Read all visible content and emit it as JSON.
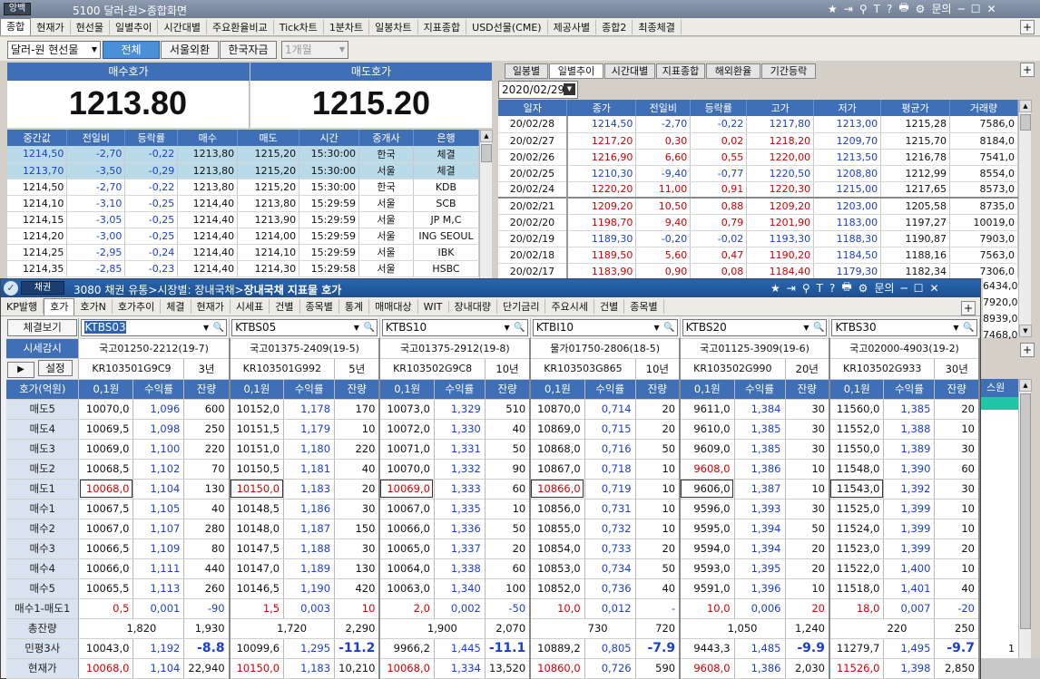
{
  "main_window": {
    "logo": "앙백",
    "title": "5100 달러-원>종합화면",
    "title_buttons": [
      "★",
      "⇥",
      "⚲",
      "T",
      "?",
      "🖶",
      "⚙",
      "문의",
      "─",
      "☐",
      "✕"
    ],
    "tabs": [
      "종합",
      "현재가",
      "현선물",
      "일별추이",
      "시간대별",
      "주요환율비교",
      "Tick차트",
      "1분차트",
      "일봉차트",
      "지표종합",
      "USD선물(CME)",
      "제공사별",
      "종합2",
      "최종체결"
    ],
    "filter": {
      "select_value": "달러-원 현선물",
      "btn_all": "전체",
      "btn_seoul": "서울외환",
      "btn_korea": "한국자금",
      "period": "1개월"
    },
    "quote": {
      "bid_label": "매수호가",
      "ask_label": "매도호가",
      "bid": "1213.80",
      "ask": "1215.20"
    },
    "trade_headers": [
      "중간값",
      "전일비",
      "등락률",
      "매수",
      "매도",
      "시간",
      "중개사",
      "은행"
    ],
    "trade_rows": [
      [
        "1214,50",
        "-2,70",
        "-0,22",
        "1213,80",
        "1215,20",
        "15:30:00",
        "한국",
        "체결"
      ],
      [
        "1213,70",
        "-3,50",
        "-0,29",
        "1213,80",
        "1215,20",
        "15:30:00",
        "서울",
        "체결"
      ],
      [
        "1214,50",
        "-2,70",
        "-0,22",
        "1213,80",
        "1215,20",
        "15:30:00",
        "한국",
        "KDB"
      ],
      [
        "1214,10",
        "-3,10",
        "-0,25",
        "1214,40",
        "1213,80",
        "15:29:59",
        "서울",
        "SCB"
      ],
      [
        "1214,15",
        "-3,05",
        "-0,25",
        "1214,40",
        "1213,90",
        "15:29:59",
        "서울",
        "JP M,C"
      ],
      [
        "1214,20",
        "-3,00",
        "-0,25",
        "1214,40",
        "1214,00",
        "15:29:59",
        "서울",
        "ING SEOUL"
      ],
      [
        "1214,25",
        "-2,95",
        "-0,24",
        "1214,40",
        "1214,10",
        "15:29:59",
        "서울",
        "IBK"
      ],
      [
        "1214,35",
        "-2,85",
        "-0,23",
        "1214,40",
        "1214,30",
        "15:29:58",
        "서울",
        "HSBC"
      ]
    ],
    "right_tabs": [
      "일봉별",
      "일별추이",
      "시간대별",
      "지표종합",
      "해외환율",
      "기간등락"
    ],
    "date": "2020/02/29",
    "daily_headers": [
      "일자",
      "종가",
      "전일비",
      "등락률",
      "고가",
      "저가",
      "평균가",
      "거래량"
    ],
    "daily_rows": [
      [
        "20/02/28",
        "1214,50",
        "-2,70",
        "-0,22",
        "1217,80",
        "1213,00",
        "1215,28",
        "7586,0"
      ],
      [
        "20/02/27",
        "1217,20",
        "0,30",
        "0,02",
        "1218,20",
        "1209,70",
        "1215,70",
        "8184,0"
      ],
      [
        "20/02/26",
        "1216,90",
        "6,60",
        "0,55",
        "1220,00",
        "1213,50",
        "1216,78",
        "7541,0"
      ],
      [
        "20/02/25",
        "1210,30",
        "-9,40",
        "-0,77",
        "1220,50",
        "1208,80",
        "1212,99",
        "8554,0"
      ],
      [
        "20/02/24",
        "1220,20",
        "11,00",
        "0,91",
        "1220,30",
        "1215,00",
        "1217,65",
        "8573,0"
      ],
      [
        "20/02/21",
        "1209,20",
        "10,50",
        "0,88",
        "1209,20",
        "1203,00",
        "1205,58",
        "8735,0"
      ],
      [
        "20/02/20",
        "1198,70",
        "9,40",
        "0,79",
        "1201,90",
        "1183,00",
        "1197,27",
        "10019,0"
      ],
      [
        "20/02/19",
        "1189,30",
        "-0,20",
        "-0,02",
        "1193,30",
        "1188,30",
        "1190,87",
        "7903,0"
      ],
      [
        "20/02/18",
        "1189,50",
        "5,60",
        "0,47",
        "1190,20",
        "1184,50",
        "1188,16",
        "7563,0"
      ],
      [
        "20/02/17",
        "1183,90",
        "0,90",
        "0,08",
        "1184,40",
        "1179,30",
        "1182,34",
        "7306,0"
      ]
    ],
    "daily_peek": [
      "6434,0",
      "7920,0",
      "8939,0",
      "7468,0"
    ],
    "side_label": "스원",
    "side_value": "1"
  },
  "bond_window": {
    "logo": "채권",
    "title_prefix": "3080 채권 유통>시장별: 장내국채>",
    "title_bold": "장내국채 지표물 호가",
    "title_buttons": [
      "★",
      "⇥",
      "⚲",
      "T",
      "?",
      "🖶",
      "⚙",
      "문의",
      "─",
      "☐",
      "✕"
    ],
    "tabs": [
      "KP발행",
      "호가",
      "호가N",
      "호가추이",
      "체결",
      "현재가",
      "시세표",
      "건별",
      "종목별",
      "통계",
      "매매대상",
      "WIT",
      "장내대량",
      "단기금리",
      "주요시세",
      "건별",
      "종목별"
    ],
    "left_btn_view": "체결보기",
    "left_btn_price": "시세감시",
    "left_btn_setting": "설정",
    "label_quote": "호가(억원)",
    "row_labels": [
      "매도5",
      "매도4",
      "매도3",
      "매도2",
      "매도1",
      "매수1",
      "매수2",
      "매수3",
      "매수4",
      "매수5",
      "매수1-매도1",
      "총잔량",
      "민평3사",
      "현재가"
    ],
    "col_headers": [
      "0,1원",
      "수익률",
      "잔량"
    ],
    "bonds": [
      {
        "code": "KTBS03",
        "name": "국고01250-2212(19-7)",
        "isin": "KR103501G9C9",
        "term": "3년",
        "rows": [
          [
            "10070,0",
            "1,096",
            "600"
          ],
          [
            "10069,5",
            "1,098",
            "250"
          ],
          [
            "10069,0",
            "1,100",
            "220"
          ],
          [
            "10068,5",
            "1,102",
            "70"
          ],
          [
            "10068,0",
            "1,104",
            "130"
          ],
          [
            "10067,5",
            "1,105",
            "40"
          ],
          [
            "10067,0",
            "1,107",
            "280"
          ],
          [
            "10066,5",
            "1,109",
            "80"
          ],
          [
            "10066,0",
            "1,111",
            "440"
          ],
          [
            "10065,5",
            "1,113",
            "260"
          ],
          [
            "0,5",
            "0,001",
            "-90"
          ],
          [
            "1,820",
            "",
            "1,930"
          ],
          [
            "10043,0",
            "1,192",
            "-8.8"
          ],
          [
            "10068,0",
            "1,104",
            "22,940"
          ]
        ]
      },
      {
        "code": "KTBS05",
        "name": "국고01375-2409(19-5)",
        "isin": "KR103501G992",
        "term": "5년",
        "rows": [
          [
            "10152,0",
            "1,178",
            "170"
          ],
          [
            "10151,5",
            "1,179",
            "10"
          ],
          [
            "10151,0",
            "1,180",
            "220"
          ],
          [
            "10150,5",
            "1,181",
            "40"
          ],
          [
            "10150,0",
            "1,183",
            "20"
          ],
          [
            "10148,5",
            "1,186",
            "30"
          ],
          [
            "10148,0",
            "1,187",
            "150"
          ],
          [
            "10147,5",
            "1,188",
            "30"
          ],
          [
            "10147,0",
            "1,189",
            "130"
          ],
          [
            "10146,5",
            "1,190",
            "420"
          ],
          [
            "1,5",
            "0,003",
            "10"
          ],
          [
            "1,720",
            "",
            "2,290"
          ],
          [
            "10099,6",
            "1,295",
            "-11.2"
          ],
          [
            "10150,0",
            "1,183",
            "10,210"
          ]
        ]
      },
      {
        "code": "KTBS10",
        "name": "국고01375-2912(19-8)",
        "isin": "KR103502G9C8",
        "term": "10년",
        "rows": [
          [
            "10073,0",
            "1,329",
            "510"
          ],
          [
            "10072,0",
            "1,330",
            "40"
          ],
          [
            "10071,0",
            "1,331",
            "50"
          ],
          [
            "10070,0",
            "1,332",
            "90"
          ],
          [
            "10069,0",
            "1,333",
            "60"
          ],
          [
            "10067,0",
            "1,335",
            "10"
          ],
          [
            "10066,0",
            "1,336",
            "50"
          ],
          [
            "10065,0",
            "1,337",
            "20"
          ],
          [
            "10064,0",
            "1,338",
            "60"
          ],
          [
            "10063,0",
            "1,340",
            "100"
          ],
          [
            "2,0",
            "0,002",
            "-50"
          ],
          [
            "1,900",
            "",
            "2,070"
          ],
          [
            "9966,2",
            "1,445",
            "-11.1"
          ],
          [
            "10068,0",
            "1,334",
            "13,520"
          ]
        ]
      },
      {
        "code": "KTBI10",
        "name": "물가01750-2806(18-5)",
        "isin": "KR103503G865",
        "term": "10년",
        "rows": [
          [
            "10870,0",
            "0,714",
            "20"
          ],
          [
            "10869,0",
            "0,715",
            "20"
          ],
          [
            "10868,0",
            "0,716",
            "50"
          ],
          [
            "10867,0",
            "0,718",
            "10"
          ],
          [
            "10866,0",
            "0,719",
            "10"
          ],
          [
            "10856,0",
            "0,731",
            "10"
          ],
          [
            "10855,0",
            "0,732",
            "10"
          ],
          [
            "10854,0",
            "0,733",
            "20"
          ],
          [
            "10853,0",
            "0,734",
            "50"
          ],
          [
            "10852,0",
            "0,736",
            "40"
          ],
          [
            "10,0",
            "0,012",
            "-"
          ],
          [
            "730",
            "",
            "720"
          ],
          [
            "10889,2",
            "0,805",
            "-7.9"
          ],
          [
            "10860,0",
            "0,726",
            "590"
          ]
        ]
      },
      {
        "code": "KTBS20",
        "name": "국고01125-3909(19-6)",
        "isin": "KR103502G990",
        "term": "20년",
        "rows": [
          [
            "9611,0",
            "1,384",
            "30"
          ],
          [
            "9610,0",
            "1,385",
            "30"
          ],
          [
            "9609,0",
            "1,385",
            "30"
          ],
          [
            "9608,0",
            "1,386",
            "10"
          ],
          [
            "9606,0",
            "1,387",
            "10"
          ],
          [
            "9596,0",
            "1,393",
            "30"
          ],
          [
            "9595,0",
            "1,394",
            "50"
          ],
          [
            "9594,0",
            "1,394",
            "20"
          ],
          [
            "9593,0",
            "1,395",
            "20"
          ],
          [
            "9591,0",
            "1,396",
            "10"
          ],
          [
            "10,0",
            "0,006",
            "20"
          ],
          [
            "1,050",
            "",
            "1,240"
          ],
          [
            "9443,3",
            "1,485",
            "-9.9"
          ],
          [
            "9608,0",
            "1,386",
            "2,030"
          ]
        ]
      },
      {
        "code": "KTBS30",
        "name": "국고02000-4903(19-2)",
        "isin": "KR103502G933",
        "term": "30년",
        "rows": [
          [
            "11560,0",
            "1,385",
            "20"
          ],
          [
            "11552,0",
            "1,388",
            "10"
          ],
          [
            "11550,0",
            "1,389",
            "30"
          ],
          [
            "11548,0",
            "1,390",
            "60"
          ],
          [
            "11543,0",
            "1,392",
            "30"
          ],
          [
            "11525,0",
            "1,399",
            "10"
          ],
          [
            "11524,0",
            "1,399",
            "10"
          ],
          [
            "11523,0",
            "1,399",
            "20"
          ],
          [
            "11522,0",
            "1,400",
            "10"
          ],
          [
            "11518,0",
            "1,401",
            "40"
          ],
          [
            "18,0",
            "0,007",
            "-20"
          ],
          [
            "220",
            "",
            "250"
          ],
          [
            "11279,7",
            "1,495",
            "-9.7"
          ],
          [
            "11526,0",
            "1,398",
            "2,850"
          ]
        ]
      }
    ]
  }
}
